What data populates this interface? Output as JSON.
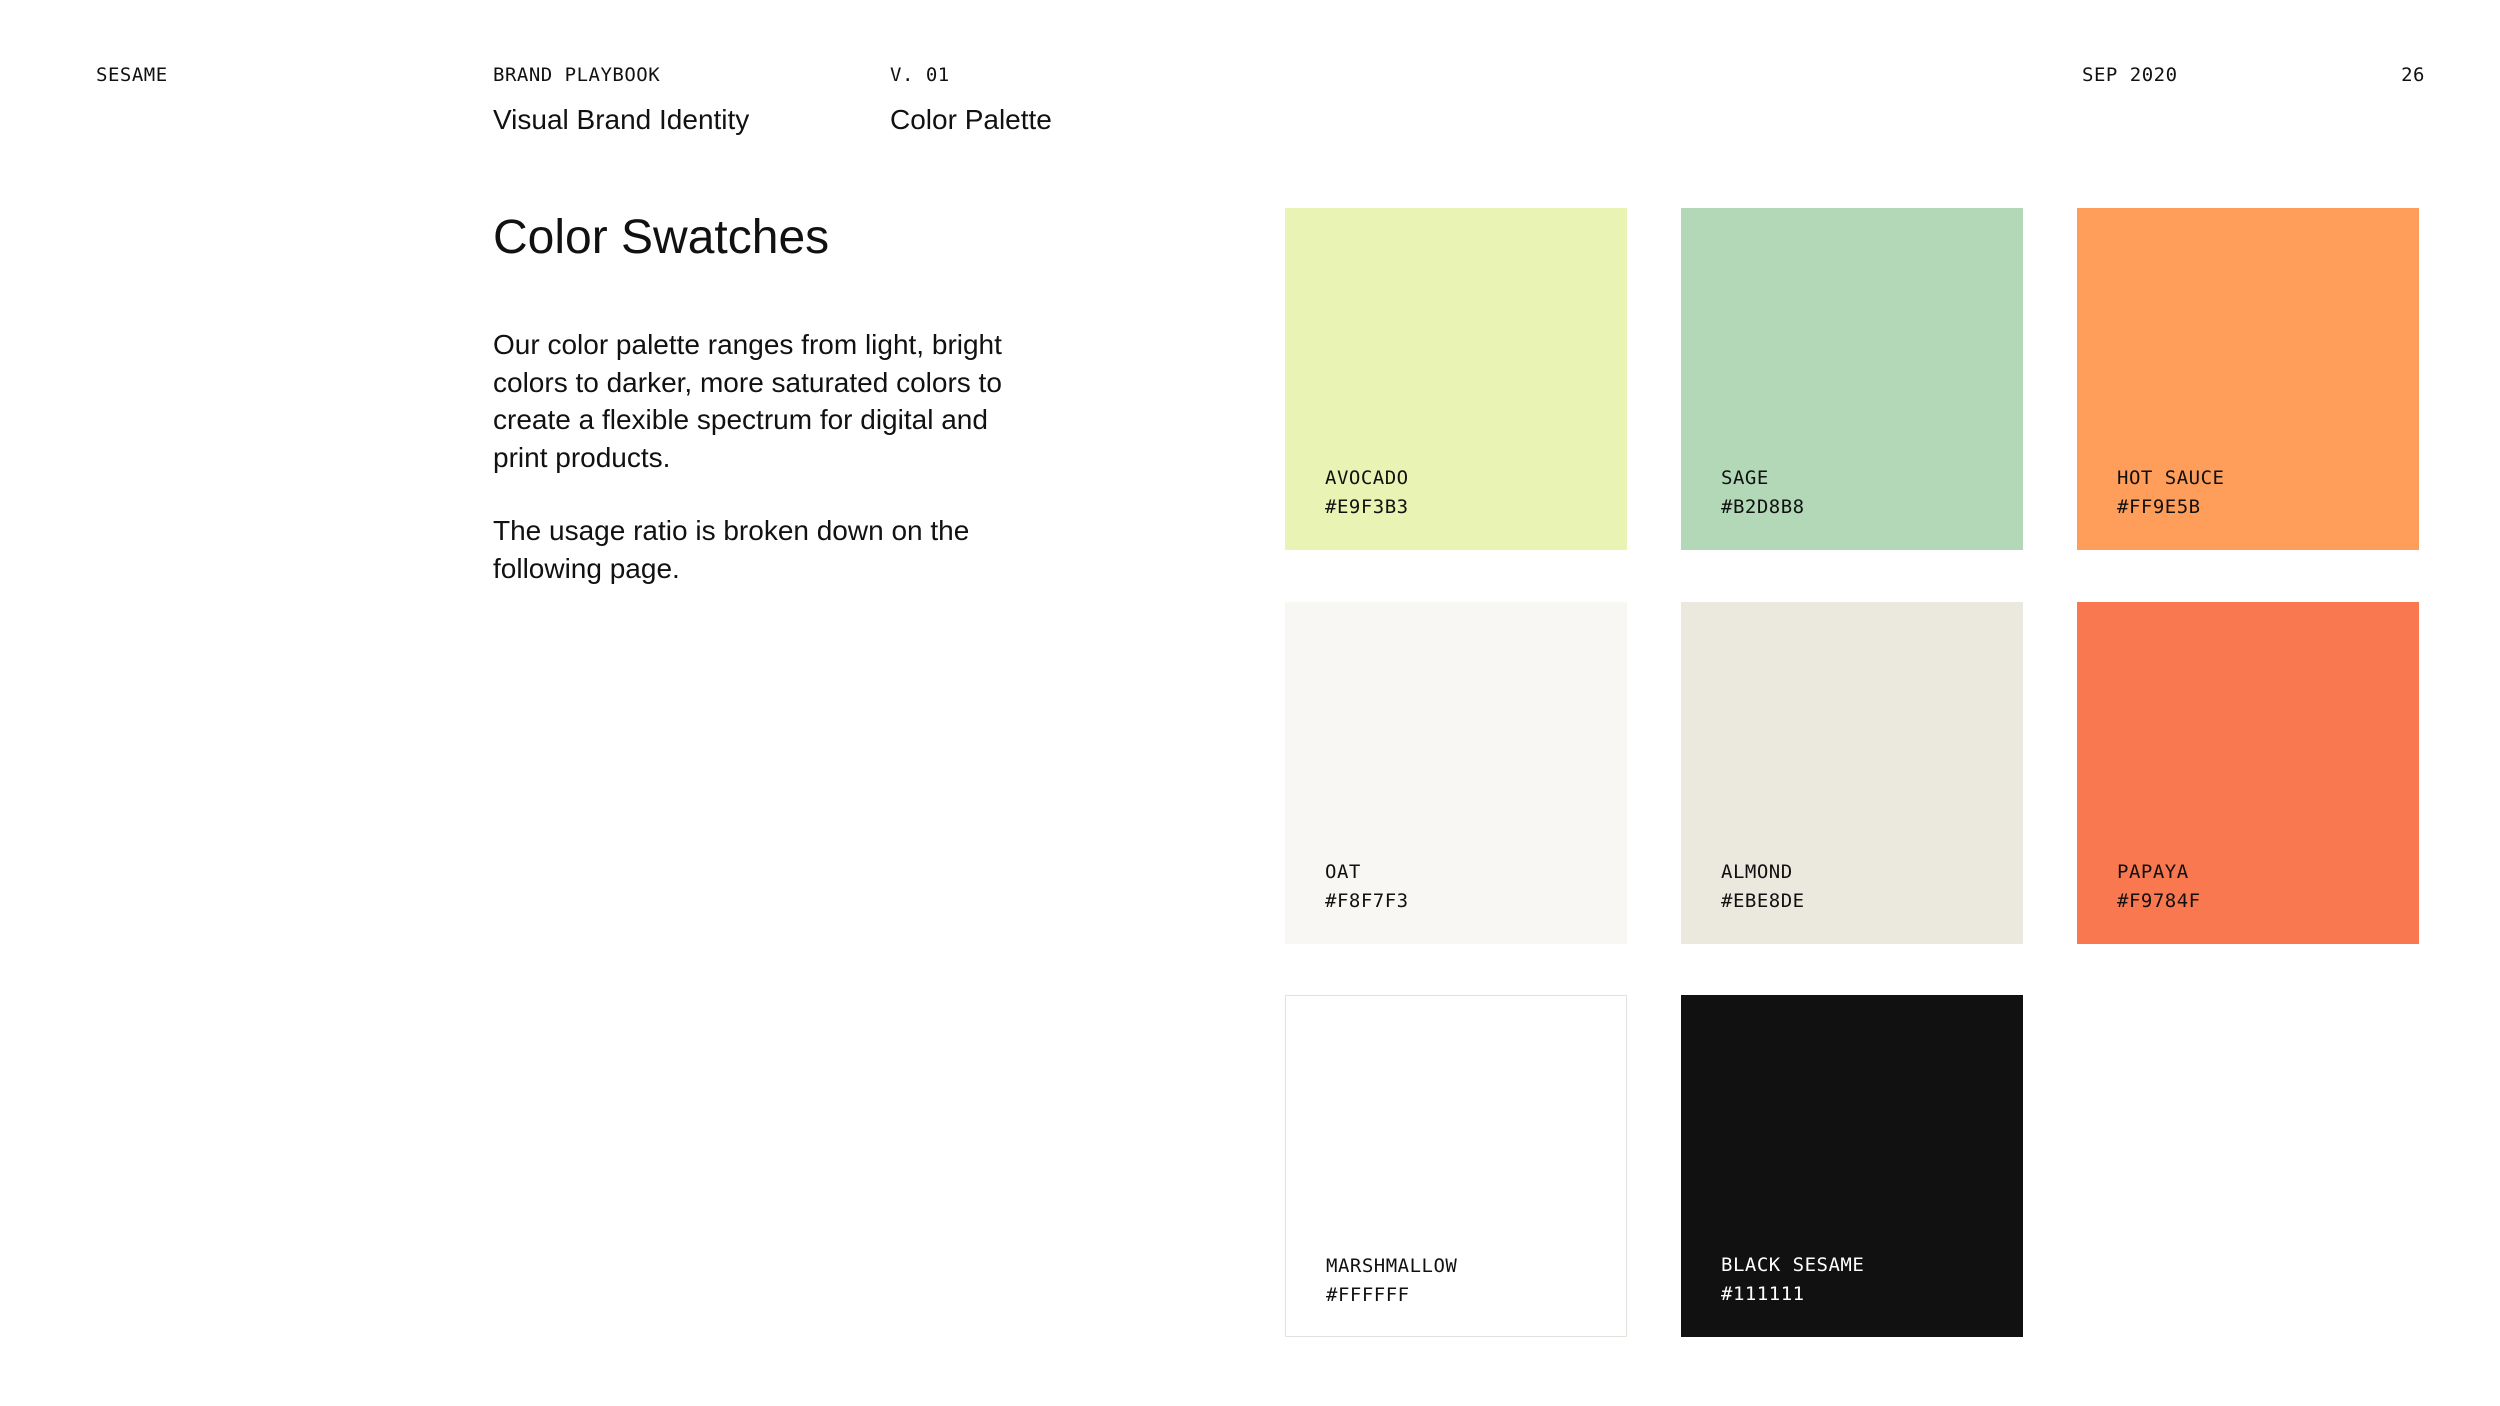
{
  "header": {
    "brand": "SESAME",
    "document": "BRAND PLAYBOOK",
    "version": "V. 01",
    "date": "SEP 2020",
    "page_number": "26",
    "section": "Visual Brand Identity",
    "subsection": "Color Palette"
  },
  "content": {
    "heading": "Color Swatches",
    "paragraphs": [
      "Our color palette ranges from light, bright colors to darker, more saturated colors to create a flexible spectrum for digital and print products.",
      "The usage ratio is broken down on the following page."
    ]
  },
  "swatches": [
    {
      "name": "AVOCADO",
      "hex": "#E9F3B3",
      "color": "#E9F3B3",
      "text_color": "#111111"
    },
    {
      "name": "SAGE",
      "hex": "#B2D8B8",
      "color": "#B2D8B8",
      "text_color": "#111111"
    },
    {
      "name": "HOT SAUCE",
      "hex": "#FF9E5B",
      "color": "#FF9E5B",
      "text_color": "#111111"
    },
    {
      "name": "OAT",
      "hex": "#F8F7F3",
      "color": "#F8F7F3",
      "text_color": "#111111"
    },
    {
      "name": "ALMOND",
      "hex": "#EBE8DE",
      "color": "#EBE8DE",
      "text_color": "#111111"
    },
    {
      "name": "PAPAYA",
      "hex": "#F9784F",
      "color": "#F9784F",
      "text_color": "#111111"
    },
    {
      "name": "MARSHMALLOW",
      "hex": "#FFFFFF",
      "color": "#FFFFFF",
      "text_color": "#111111",
      "bordered": true
    },
    {
      "name": "BLACK SESAME",
      "hex": "#111111",
      "color": "#111111",
      "text_color": "#FFFFFF"
    }
  ]
}
